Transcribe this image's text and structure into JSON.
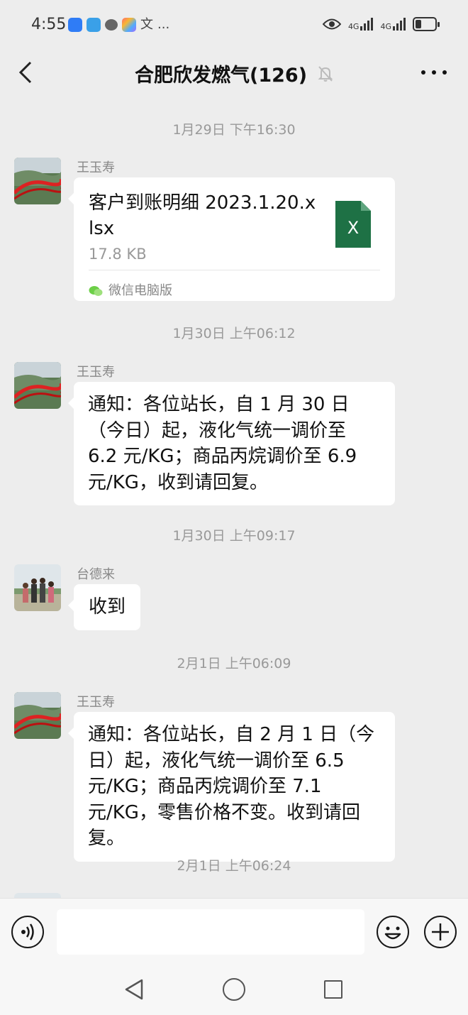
{
  "status_bar": {
    "time": "4:55",
    "dots": "...",
    "text_icon": "文",
    "network_label_1": "4G",
    "network_label_2": "4G",
    "icons": [
      "app-blue-icon",
      "weather-icon",
      "message-icon",
      "app-colorful-icon",
      "text-icon",
      "eye-icon",
      "signal-icon",
      "battery-icon"
    ]
  },
  "header": {
    "title": "合肥欣发燃气(126)",
    "back_icon": "chevron-left-icon",
    "mute_icon": "bell-off-icon",
    "more_icon": "more-dots-icon"
  },
  "messages": [
    {
      "timestamp": "1月29日 下午16:30",
      "sender": "王玉寿",
      "type": "file",
      "file_name": "客户到账明细 2023.1.20.xlsx",
      "file_size": "17.8 KB",
      "file_icon_letter": "X",
      "source": "微信电脑版"
    },
    {
      "timestamp": "1月30日 上午06:12",
      "sender": "王玉寿",
      "type": "text",
      "text": "通知：各位站长，自 1 月 30 日（今日）起，液化气统一调价至 6.2 元/KG；商品丙烷调价至 6.9 元/KG，收到请回复。"
    },
    {
      "timestamp": "1月30日 上午09:17",
      "sender": "台德来",
      "type": "text",
      "text": "收到"
    },
    {
      "timestamp": "2月1日 上午06:09",
      "sender": "王玉寿",
      "type": "text",
      "text": "通知：各位站长，自 2 月 1 日（今日）起，液化气统一调价至 6.5 元/KG；商品丙烷调价至 7.1 元/KG，零售价格不变。收到请回复。"
    },
    {
      "timestamp": "2月1日 上午06:24"
    }
  ],
  "input_bar": {
    "value": "",
    "placeholder": "",
    "icons": [
      "voice-icon",
      "emoji-icon",
      "plus-icon"
    ]
  },
  "system_nav": {
    "icons": [
      "nav-back-icon",
      "nav-home-icon",
      "nav-recents-icon"
    ]
  },
  "colors": {
    "background": "#ededed",
    "bubble": "#ffffff",
    "excel_green": "#1e7145",
    "timestamp_text": "#999999"
  }
}
